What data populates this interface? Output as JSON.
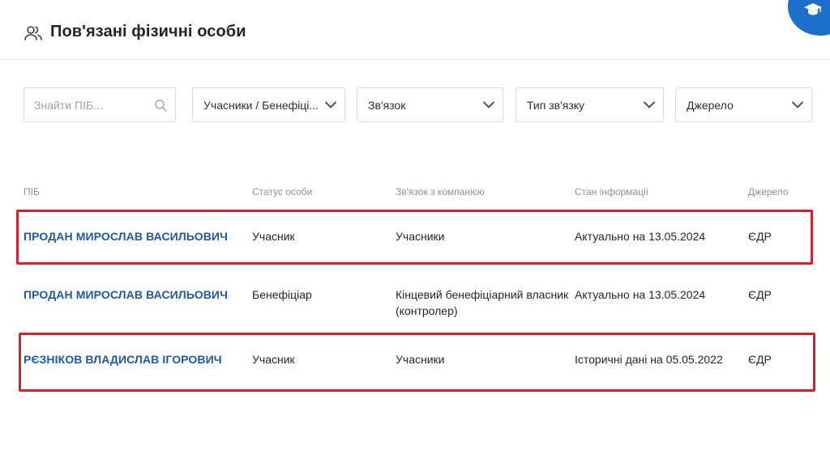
{
  "header": {
    "title": "Пов'язані фізичні особи",
    "icon": "users-icon",
    "corner_icon": "graduation-cap-icon",
    "accent_color": "#1b6fcb"
  },
  "filters": {
    "search_placeholder": "Знайти ПІБ...",
    "role": "Учасники / Бенефіці...",
    "relation": "Зв'язок",
    "relation_type": "Тип зв'язку",
    "source": "Джерело"
  },
  "table": {
    "columns": [
      "ПІБ",
      "Статус особи",
      "Зв'язок з компанією",
      "Стан інформації",
      "Джерело"
    ],
    "rows": [
      {
        "name": "ПРОДАН МИРОСЛАВ ВАСИЛЬОВИЧ",
        "status": "Учасник",
        "relation_line1": "Учасники",
        "relation_line2": "",
        "info_state": "Актуально на 13.05.2024",
        "source": "ЄДР",
        "highlighted": true
      },
      {
        "name": "ПРОДАН МИРОСЛАВ ВАСИЛЬОВИЧ",
        "status": "Бенефіціар",
        "relation_line1": "Кінцевий бенефіціарний власник",
        "relation_line2": "(контролер)",
        "info_state": "Актуально на 13.05.2024",
        "source": "ЄДР",
        "highlighted": false
      },
      {
        "name": "РЄЗНІКОВ ВЛАДИСЛАВ ІГОРОВИЧ",
        "status": "Учасник",
        "relation_line1": "Учасники",
        "relation_line2": "",
        "info_state": "Історичні дані на 05.05.2022",
        "source": "ЄДР",
        "highlighted": true
      }
    ]
  },
  "colors": {
    "link": "#1e5aa0",
    "highlight": "#d3222c"
  }
}
